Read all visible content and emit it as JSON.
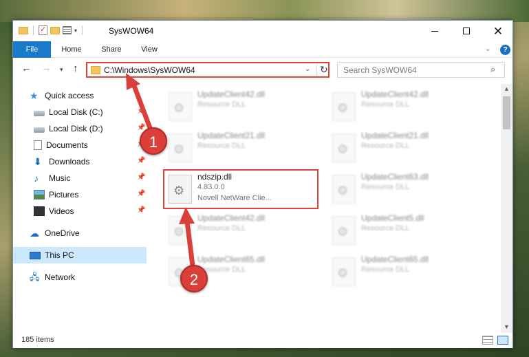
{
  "window": {
    "title": "SysWOW64",
    "controls": {
      "minimize": "",
      "maximize": "",
      "close": "✕"
    }
  },
  "ribbon": {
    "tabs": [
      {
        "label": "File"
      },
      {
        "label": "Home"
      },
      {
        "label": "Share"
      },
      {
        "label": "View"
      }
    ],
    "help": "?"
  },
  "navigation": {
    "address_path": "C:\\Windows\\SysWOW64",
    "search_placeholder": "Search SysWOW64"
  },
  "sidebar": {
    "items": [
      {
        "label": "Quick access",
        "icon": "star-icon"
      },
      {
        "label": "Local Disk (C:)",
        "icon": "disk-icon",
        "pinned": true
      },
      {
        "label": "Local Disk (D:)",
        "icon": "disk-icon",
        "pinned": true
      },
      {
        "label": "Documents",
        "icon": "documents-icon",
        "pinned": true
      },
      {
        "label": "Downloads",
        "icon": "downloads-icon",
        "pinned": true
      },
      {
        "label": "Music",
        "icon": "music-icon",
        "pinned": true
      },
      {
        "label": "Pictures",
        "icon": "pictures-icon",
        "pinned": true
      },
      {
        "label": "Videos",
        "icon": "videos-icon",
        "pinned": true
      },
      {
        "label": "OneDrive",
        "icon": "onedrive-icon"
      },
      {
        "label": "This PC",
        "icon": "this-pc-icon",
        "selected": true
      },
      {
        "label": "Network",
        "icon": "network-icon"
      }
    ]
  },
  "files": [
    {
      "name": "UpdateClient42.dll",
      "desc": "Resource DLL"
    },
    {
      "name": "UpdateClient42.dll",
      "desc": "Resource DLL"
    },
    {
      "name": "UpdateClient21.dll",
      "desc": "Resource DLL"
    },
    {
      "name": "UpdateClient21.dll",
      "desc": "Resource DLL"
    },
    {
      "name": "ndszip.dll",
      "desc": "4.83.0.0",
      "desc2": "Novell NetWare Clie...",
      "highlighted": true
    },
    {
      "name": "UpdateClient63.dll",
      "desc": "Resource DLL"
    },
    {
      "name": "UpdateClient42.dll",
      "desc": "Resource DLL"
    },
    {
      "name": "UpdateClient5.dll",
      "desc": "Resource DLL"
    },
    {
      "name": "UpdateClient65.dll",
      "desc": "Resource DLL"
    },
    {
      "name": "UpdateClient65.dll",
      "desc": "Resource DLL"
    }
  ],
  "status": {
    "item_count": "185 items"
  },
  "annotations": {
    "step1": "1",
    "step2": "2",
    "color": "#d9403a"
  },
  "colors": {
    "accent": "#1979ca",
    "highlight_border": "#e0433a",
    "selected_bg": "#cce8ff"
  }
}
